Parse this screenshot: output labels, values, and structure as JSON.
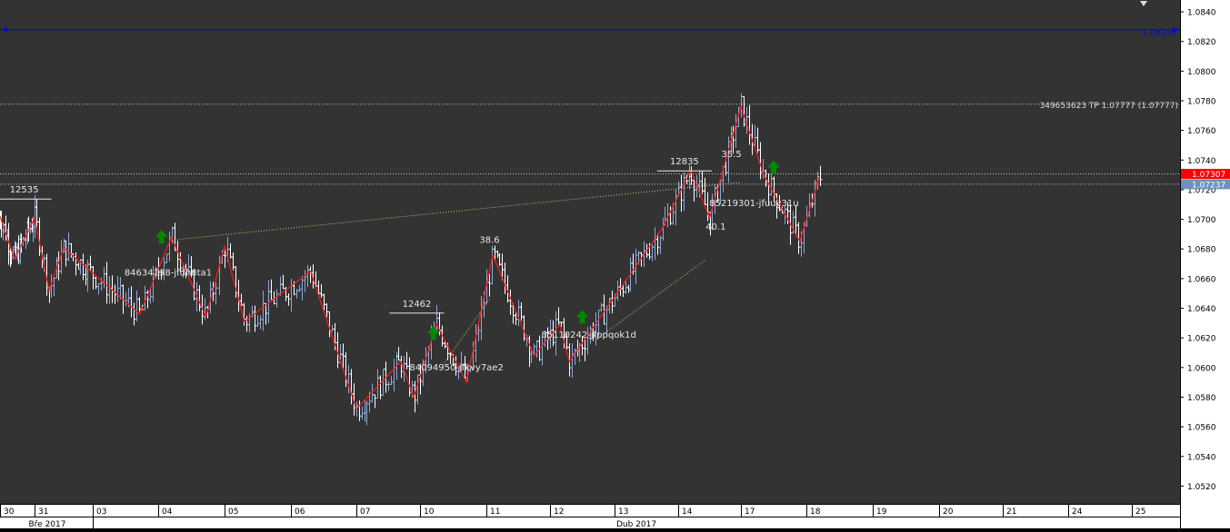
{
  "colors": {
    "background": "#333333",
    "frame": "#000000",
    "bar_up": "#8ea8d6",
    "bar_down": "#ffffff",
    "zigzag": "#ff1a1a",
    "blue_line": "#0000ff",
    "grid_dotted": "#c8c8c8",
    "trade_link": "#c8c87a",
    "signal_arrow": "#008800",
    "current_price_badge": "#ff0000",
    "bid_badge": "#6e8fc0"
  },
  "chart_data": {
    "type": "ohlc",
    "instrument_scale": "price",
    "ylim": [
      1.0508,
      1.0848
    ],
    "y_ticks": [
      "1.0840",
      "1.0820",
      "1.0800",
      "1.0780",
      "1.0760",
      "1.0740",
      "1.0720",
      "1.0700",
      "1.0680",
      "1.0660",
      "1.0640",
      "1.0620",
      "1.0600",
      "1.0580",
      "1.0560",
      "1.0540",
      "1.0520"
    ],
    "x_day_labels": [
      "30",
      "31",
      "03",
      "04",
      "05",
      "06",
      "07",
      "10",
      "11",
      "12",
      "13",
      "14",
      "17",
      "18",
      "19",
      "20",
      "21",
      "24",
      "25"
    ],
    "x_month_labels": [
      "Bře 2017",
      "Dub 2017"
    ],
    "horizontal_lines": [
      {
        "price": 1.0828,
        "style": "solid",
        "color_key": "blue_line",
        "label": "1.08280"
      },
      {
        "price": 1.07777,
        "style": "dotted",
        "label": "349653623 TP 1.07777 (1.07777)"
      },
      {
        "price": 1.07307,
        "style": "dotted",
        "label": ""
      },
      {
        "price": 1.07237,
        "style": "dotted",
        "label": ""
      }
    ],
    "price_badges": [
      {
        "price": 1.07307,
        "label": "1.07307",
        "color_key": "current_price_badge"
      },
      {
        "price": 1.07237,
        "label": "1.07237",
        "color_key": "bid_badge"
      }
    ],
    "zigzag": [
      {
        "day": 0.0,
        "price": 1.0702
      },
      {
        "day": 0.42,
        "price": 1.0673
      },
      {
        "day": 1.0,
        "price": 1.0701
      },
      {
        "day": 1.25,
        "price": 1.0652
      },
      {
        "day": 1.5,
        "price": 1.0681
      },
      {
        "day": 2.72,
        "price": 1.0636
      },
      {
        "day": 3.2,
        "price": 1.0688
      },
      {
        "day": 3.72,
        "price": 1.0634
      },
      {
        "day": 4.0,
        "price": 1.0682
      },
      {
        "day": 4.3,
        "price": 1.0631
      },
      {
        "day": 5.3,
        "price": 1.0665
      },
      {
        "day": 6.0,
        "price": 1.0572
      },
      {
        "day": 6.7,
        "price": 1.0604
      },
      {
        "day": 6.9,
        "price": 1.058
      },
      {
        "day": 7.25,
        "price": 1.0629
      },
      {
        "day": 7.7,
        "price": 1.059
      },
      {
        "day": 8.1,
        "price": 1.0676
      },
      {
        "day": 8.75,
        "price": 1.0608
      },
      {
        "day": 9.15,
        "price": 1.0629
      },
      {
        "day": 9.3,
        "price": 1.0604
      },
      {
        "day": 10.75,
        "price": 1.0694
      },
      {
        "day": 11.2,
        "price": 1.0733
      },
      {
        "day": 11.5,
        "price": 1.0701
      },
      {
        "day": 12.0,
        "price": 1.0776
      },
      {
        "day": 12.35,
        "price": 1.073
      },
      {
        "day": 12.9,
        "price": 1.0685
      },
      {
        "day": 13.2,
        "price": 1.0729
      }
    ],
    "annotations": [
      {
        "text": "12535",
        "day": 0.7,
        "price": 1.0718
      },
      {
        "text": "84634138-jfdh8ta1",
        "day": 3.15,
        "price": 1.0662
      },
      {
        "text": "12462",
        "day": 6.95,
        "price": 1.0641
      },
      {
        "text": "84094950-jfkvy7ae2",
        "day": 7.55,
        "price": 1.0598
      },
      {
        "text": "38.6",
        "day": 8.05,
        "price": 1.0684
      },
      {
        "text": "85110242-jfppqok1d",
        "day": 9.6,
        "price": 1.062
      },
      {
        "text": "12835",
        "day": 11.1,
        "price": 1.0737
      },
      {
        "text": "35.5",
        "day": 11.85,
        "price": 1.0742
      },
      {
        "text": "85219301-jfuuv31u",
        "day": 12.2,
        "price": 1.0709
      },
      {
        "text": "40.1",
        "day": 11.6,
        "price": 1.0693
      }
    ],
    "signal_arrows": [
      {
        "day": 3.05,
        "price": 1.0688
      },
      {
        "day": 7.2,
        "price": 1.0623
      },
      {
        "day": 9.5,
        "price": 1.0634
      },
      {
        "day": 12.5,
        "price": 1.0735
      }
    ]
  }
}
